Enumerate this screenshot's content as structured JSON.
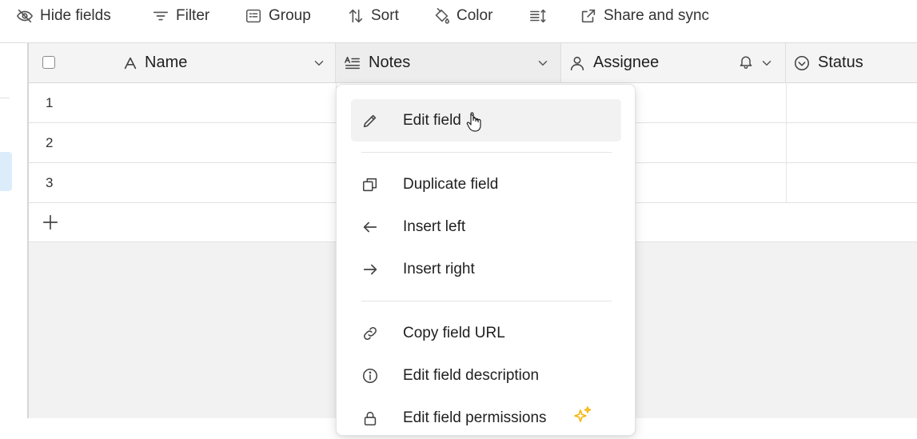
{
  "toolbar": {
    "hide_fields": "Hide fields",
    "filter": "Filter",
    "group": "Group",
    "sort": "Sort",
    "color": "Color",
    "share_sync": "Share and sync"
  },
  "columns": [
    {
      "label": "Name",
      "icon": "text-a-icon"
    },
    {
      "label": "Notes",
      "icon": "long-text-icon"
    },
    {
      "label": "Assignee",
      "icon": "user-icon"
    },
    {
      "label": "Status",
      "icon": "status-circle-icon"
    }
  ],
  "rows": [
    {
      "number": "1"
    },
    {
      "number": "2"
    },
    {
      "number": "3"
    }
  ],
  "menu": {
    "items": [
      {
        "label": "Edit field",
        "icon": "pencil-icon"
      },
      {
        "label": "Duplicate field",
        "icon": "duplicate-icon"
      },
      {
        "label": "Insert left",
        "icon": "arrow-left-icon"
      },
      {
        "label": "Insert right",
        "icon": "arrow-right-icon"
      },
      {
        "label": "Copy field URL",
        "icon": "link-icon"
      },
      {
        "label": "Edit field description",
        "icon": "info-icon"
      },
      {
        "label": "Edit field permissions",
        "icon": "lock-icon"
      }
    ]
  },
  "colors": {
    "accent_sparkle": "#f5b400",
    "selected_sidebar": "#dcecfb"
  }
}
